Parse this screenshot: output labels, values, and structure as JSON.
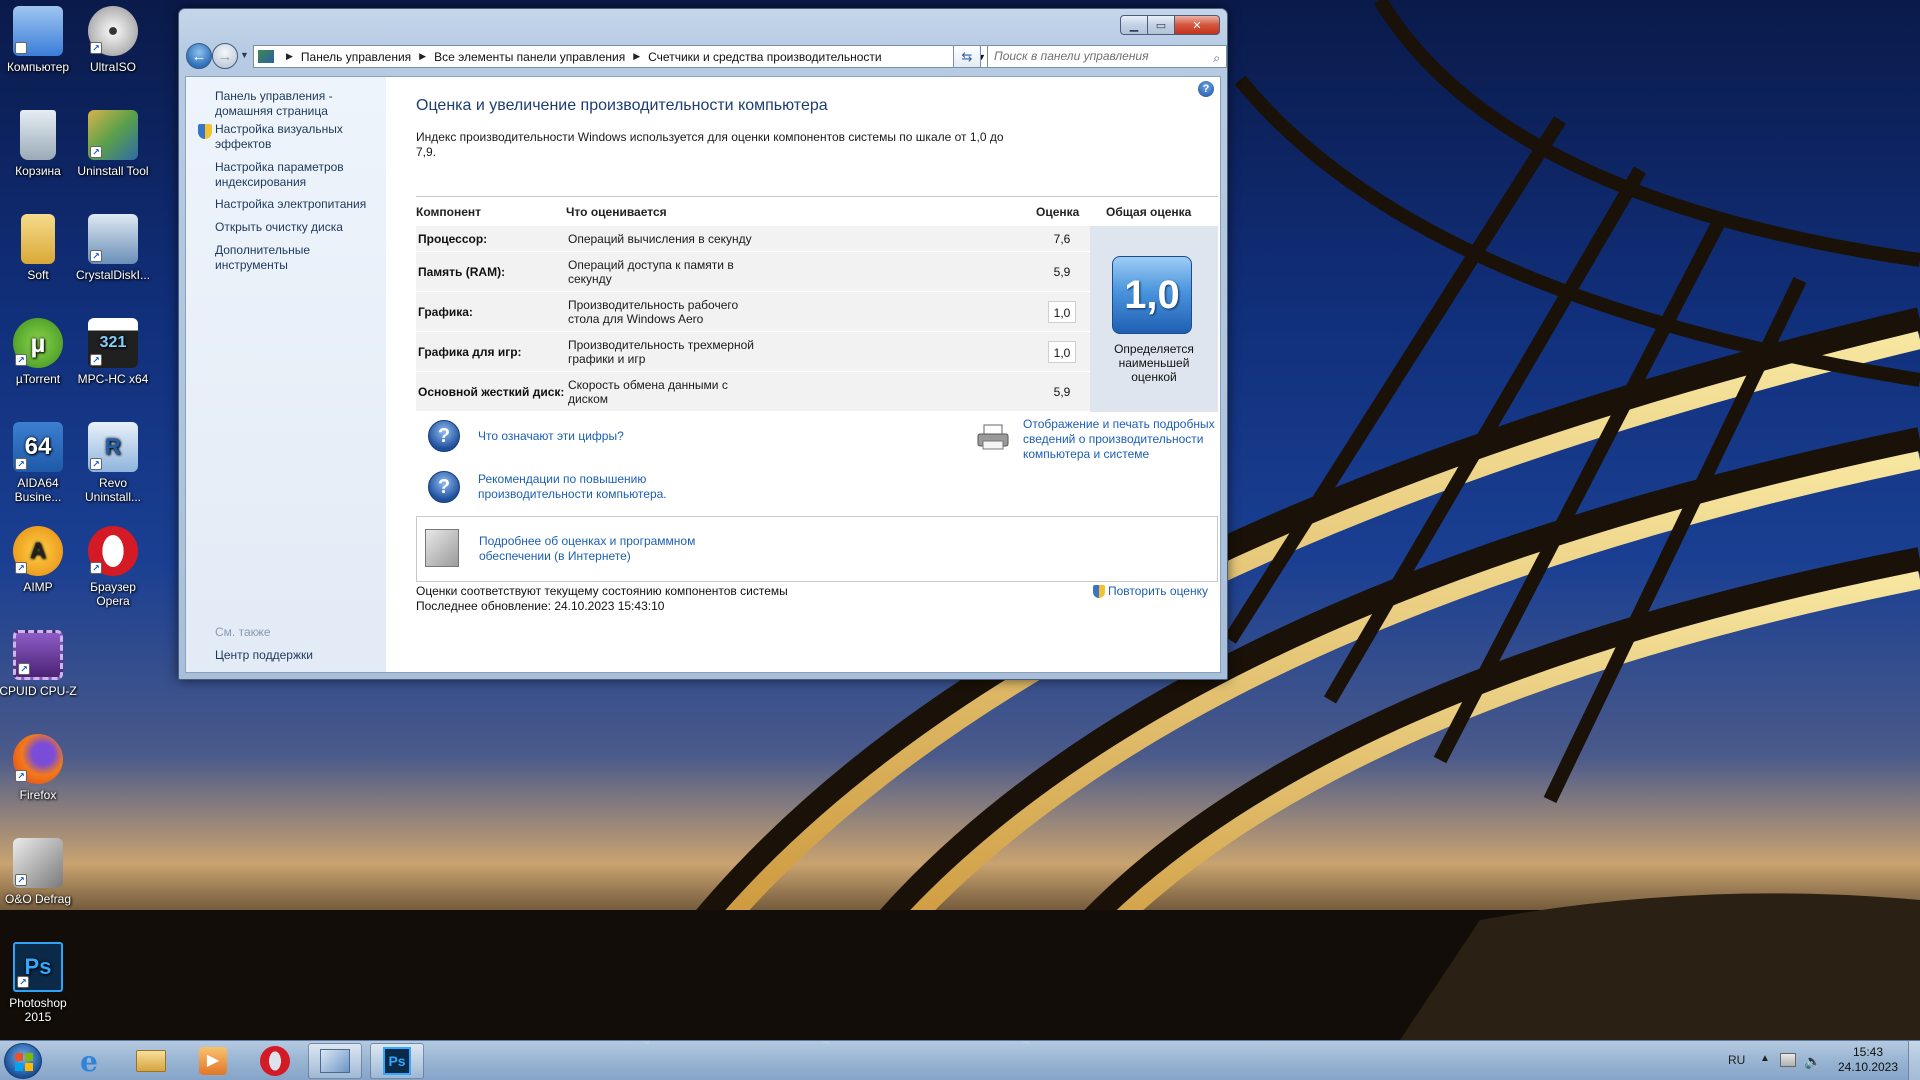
{
  "desktop": {
    "icons": [
      {
        "label": "Компьютер",
        "color": "#3b7dd8",
        "icon": "computer-icon"
      },
      {
        "label": "UltraISO",
        "color": "#9a9a9a",
        "icon": "disc-icon"
      },
      {
        "label": "Корзина",
        "color": "#b8c4cc",
        "icon": "recycle-bin-icon"
      },
      {
        "label": "Uninstall Tool",
        "color": "#5aa04a",
        "icon": "uninstall-tool-icon"
      },
      {
        "label": "Soft",
        "color": "#e8c25a",
        "icon": "folder-icon"
      },
      {
        "label": "CrystalDiskI...",
        "color": "#6a8fb8",
        "icon": "crystaldisk-icon"
      },
      {
        "label": "µTorrent",
        "color": "#6bbd35",
        "icon": "utorrent-icon",
        "glyph": "µ"
      },
      {
        "label": "MPC-HC x64",
        "color": "#303030",
        "icon": "mpc-hc-icon",
        "glyph": "321"
      },
      {
        "label": "AIDA64 Busine...",
        "color": "#1e5aa8",
        "icon": "aida64-icon",
        "glyph": "64"
      },
      {
        "label": "Revo Uninstall...",
        "color": "#4a8ad0",
        "icon": "revo-icon",
        "glyph": "R"
      },
      {
        "label": "AIMP",
        "color": "#f2a516",
        "icon": "aimp-icon",
        "glyph": "A"
      },
      {
        "label": "Браузер Opera",
        "color": "#d41a25",
        "icon": "opera-icon",
        "glyph": "O"
      },
      {
        "label": "CPUID CPU-Z",
        "color": "#5b2e8a",
        "icon": "cpu-z-icon"
      },
      {
        "label": "Firefox",
        "color": "#e8631c",
        "icon": "firefox-icon"
      },
      {
        "label": "O&O Defrag",
        "color": "#7a7a7a",
        "icon": "defrag-icon"
      },
      {
        "label": "Photoshop 2015",
        "color": "#0b2a48",
        "icon": "photoshop-icon",
        "glyph": "Ps"
      }
    ]
  },
  "window": {
    "breadcrumbs": [
      "Панель управления",
      "Все элементы панели управления",
      "Счетчики и средства производительности"
    ],
    "search_placeholder": "Поиск в панели управления",
    "sidebar": {
      "home": "Панель управления - домашняя страница",
      "links": [
        "Настройка визуальных эффектов",
        "Настройка параметров индексирования",
        "Настройка электропитания",
        "Открыть очистку диска",
        "Дополнительные инструменты"
      ],
      "see_also": "См. также",
      "support": "Центр поддержки"
    },
    "title": "Оценка и увеличение производительности компьютера",
    "intro": "Индекс производительности Windows используется для оценки компонентов системы по шкале от 1,0 до 7,9.",
    "table": {
      "headers": {
        "component": "Компонент",
        "what": "Что оценивается",
        "score": "Оценка",
        "base": "Общая оценка"
      },
      "rows": [
        {
          "component": "Процессор:",
          "what": "Операций вычисления в секунду",
          "score": "7,6"
        },
        {
          "component": "Память (RAM):",
          "what": "Операций доступа к памяти в секунду",
          "score": "5,9"
        },
        {
          "component": "Графика:",
          "what": "Производительность рабочего стола для Windows Aero",
          "score": "1,0"
        },
        {
          "component": "Графика для игр:",
          "what": "Производительность трехмерной графики и игр",
          "score": "1,0"
        },
        {
          "component": "Основной жесткий диск:",
          "what": "Скорость обмена данными с диском",
          "score": "5,9"
        }
      ],
      "base_score": "1,0",
      "base_caption": "Определяется наименьшей оценкой"
    },
    "links": {
      "meaning": "Что означают эти цифры?",
      "tips": "Рекомендации по повышению производительности компьютера.",
      "print": "Отображение и печать подробных сведений о производительности компьютера и системе",
      "online": "Подробнее об оценках и программном обеспечении (в Интернете)"
    },
    "status_line1": "Оценки соответствуют текущему состоянию компонентов системы",
    "status_line2": "Последнее обновление: 24.10.2023 15:43:10",
    "rerun": "Повторить оценку"
  },
  "taskbar": {
    "apps": [
      "internet-explorer-icon",
      "explorer-icon",
      "media-player-icon",
      "opera-icon",
      "control-panel-icon",
      "photoshop-icon"
    ],
    "lang": "RU",
    "time": "15:43",
    "date": "24.10.2023"
  }
}
